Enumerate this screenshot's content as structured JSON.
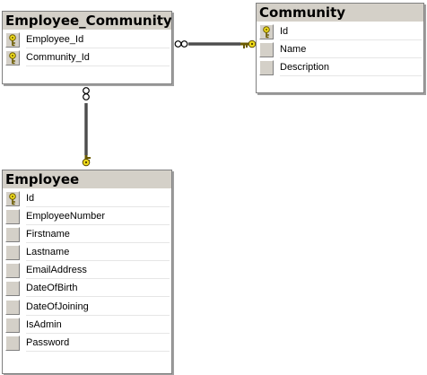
{
  "diagram": {
    "tables": {
      "employee_community": {
        "title": "Employee_Community",
        "columns": [
          {
            "name": "Employee_Id",
            "primary_key": true
          },
          {
            "name": "Community_Id",
            "primary_key": true
          }
        ]
      },
      "community": {
        "title": "Community",
        "columns": [
          {
            "name": "Id",
            "primary_key": true
          },
          {
            "name": "Name",
            "primary_key": false
          },
          {
            "name": "Description",
            "primary_key": false
          }
        ]
      },
      "employee": {
        "title": "Employee",
        "columns": [
          {
            "name": "Id",
            "primary_key": true
          },
          {
            "name": "EmployeeNumber",
            "primary_key": false
          },
          {
            "name": "Firstname",
            "primary_key": false
          },
          {
            "name": "Lastname",
            "primary_key": false
          },
          {
            "name": "EmailAddress",
            "primary_key": false
          },
          {
            "name": "DateOfBirth",
            "primary_key": false
          },
          {
            "name": "DateOfJoining",
            "primary_key": false
          },
          {
            "name": "IsAdmin",
            "primary_key": false
          },
          {
            "name": "Password",
            "primary_key": false
          }
        ]
      }
    },
    "relationships": [
      {
        "from": "Employee_Community",
        "to": "Community",
        "from_end": "infinity",
        "to_end": "key"
      },
      {
        "from": "Employee_Community",
        "to": "Employee",
        "from_end": "infinity",
        "to_end": "key"
      }
    ],
    "colors": {
      "title_bar": "#d4d0c8",
      "border": "#808080",
      "shadow": "#a0a0a0",
      "key": "#e8d000"
    }
  }
}
